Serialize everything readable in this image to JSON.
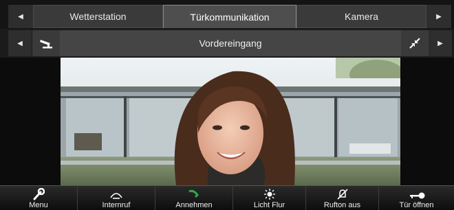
{
  "tabs": [
    {
      "label": "Wetterstation",
      "active": false
    },
    {
      "label": "Türkommunikation",
      "active": true
    },
    {
      "label": "Kamera",
      "active": false
    }
  ],
  "camera": {
    "title": "Vordereingang",
    "left_icon": "camera-icon",
    "right_icon": "collapse-icon"
  },
  "toolbar": {
    "items": [
      {
        "label": "Menu",
        "icon": "wrench-icon"
      },
      {
        "label": "Internruf",
        "icon": "intercom-icon"
      },
      {
        "label": "Annehmen",
        "icon": "phone-accept-icon"
      },
      {
        "label": "Licht Flur",
        "icon": "light-icon"
      },
      {
        "label": "Rufton aus",
        "icon": "bell-off-icon"
      },
      {
        "label": "Tür öffnen",
        "icon": "key-icon"
      }
    ]
  },
  "colors": {
    "bar": "#141414",
    "tab": "#3a3a3a",
    "tab_active": "#4e4e4e",
    "title_bar": "#454545",
    "accept": "#2fa84f"
  }
}
